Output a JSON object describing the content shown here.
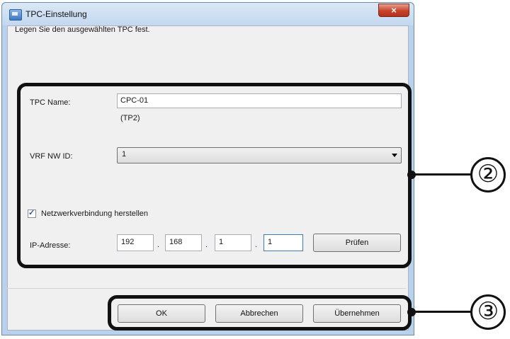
{
  "window": {
    "title": "TPC-Einstellung",
    "close_glyph": "×"
  },
  "instruction": "Legen Sie den ausgewählten TPC fest.",
  "tpc_name": {
    "label": "TPC Name:",
    "value": "CPC-01",
    "sub": "(TP2)"
  },
  "vrf": {
    "label": "VRF NW ID:",
    "selected": "1"
  },
  "network": {
    "checkbox_label": "Netzwerkverbindung herstellen",
    "checked": true
  },
  "ip": {
    "label": "IP-Adresse:",
    "octets": [
      "192",
      "168",
      "1",
      "1"
    ],
    "separator": ".",
    "check_button": "Prüfen"
  },
  "buttons": {
    "ok": "OK",
    "cancel": "Abbrechen",
    "apply": "Übernehmen"
  },
  "callouts": [
    "②",
    "③"
  ]
}
